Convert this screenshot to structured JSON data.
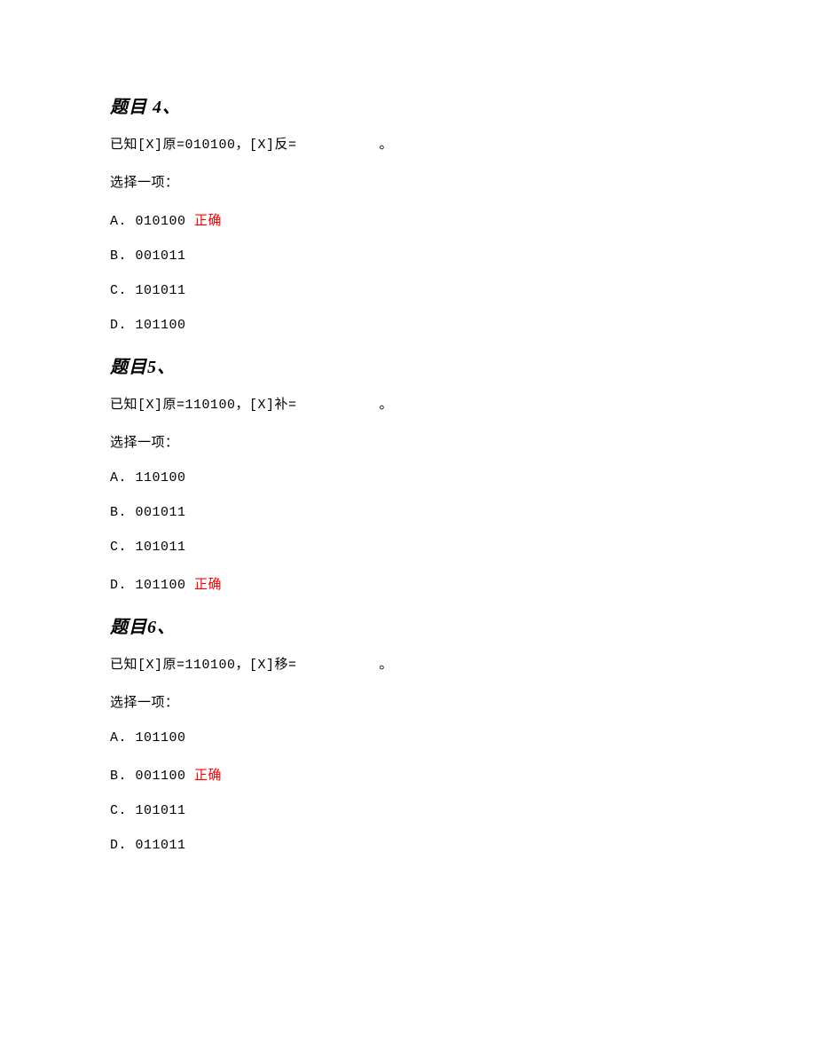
{
  "questions": [
    {
      "title": "题目 4、",
      "stem": "已知[X]原=010100，[X]反=　　　　　　。",
      "selectPrompt": "选择一项：",
      "options": [
        {
          "label": "A. 010100",
          "correct": true,
          "correctLabel": " 正确"
        },
        {
          "label": "B. 001011",
          "correct": false,
          "correctLabel": ""
        },
        {
          "label": "C. 101011",
          "correct": false,
          "correctLabel": ""
        },
        {
          "label": "D. 101100",
          "correct": false,
          "correctLabel": ""
        }
      ]
    },
    {
      "title": "题目5、",
      "stem": "已知[X]原=110100，[X]补=　　　　　　。",
      "selectPrompt": "选择一项：",
      "options": [
        {
          "label": "A. 110100",
          "correct": false,
          "correctLabel": ""
        },
        {
          "label": "B. 001011",
          "correct": false,
          "correctLabel": ""
        },
        {
          "label": "C. 101011",
          "correct": false,
          "correctLabel": ""
        },
        {
          "label": "D. 101100",
          "correct": true,
          "correctLabel": " 正确"
        }
      ]
    },
    {
      "title": "题目6、",
      "stem": "已知[X]原=110100，[X]移=　　　　　　。",
      "selectPrompt": "选择一项：",
      "options": [
        {
          "label": "A. 101100",
          "correct": false,
          "correctLabel": ""
        },
        {
          "label": "B. 001100",
          "correct": true,
          "correctLabel": " 正确"
        },
        {
          "label": "C. 101011",
          "correct": false,
          "correctLabel": ""
        },
        {
          "label": "D. 011011",
          "correct": false,
          "correctLabel": ""
        }
      ]
    }
  ]
}
